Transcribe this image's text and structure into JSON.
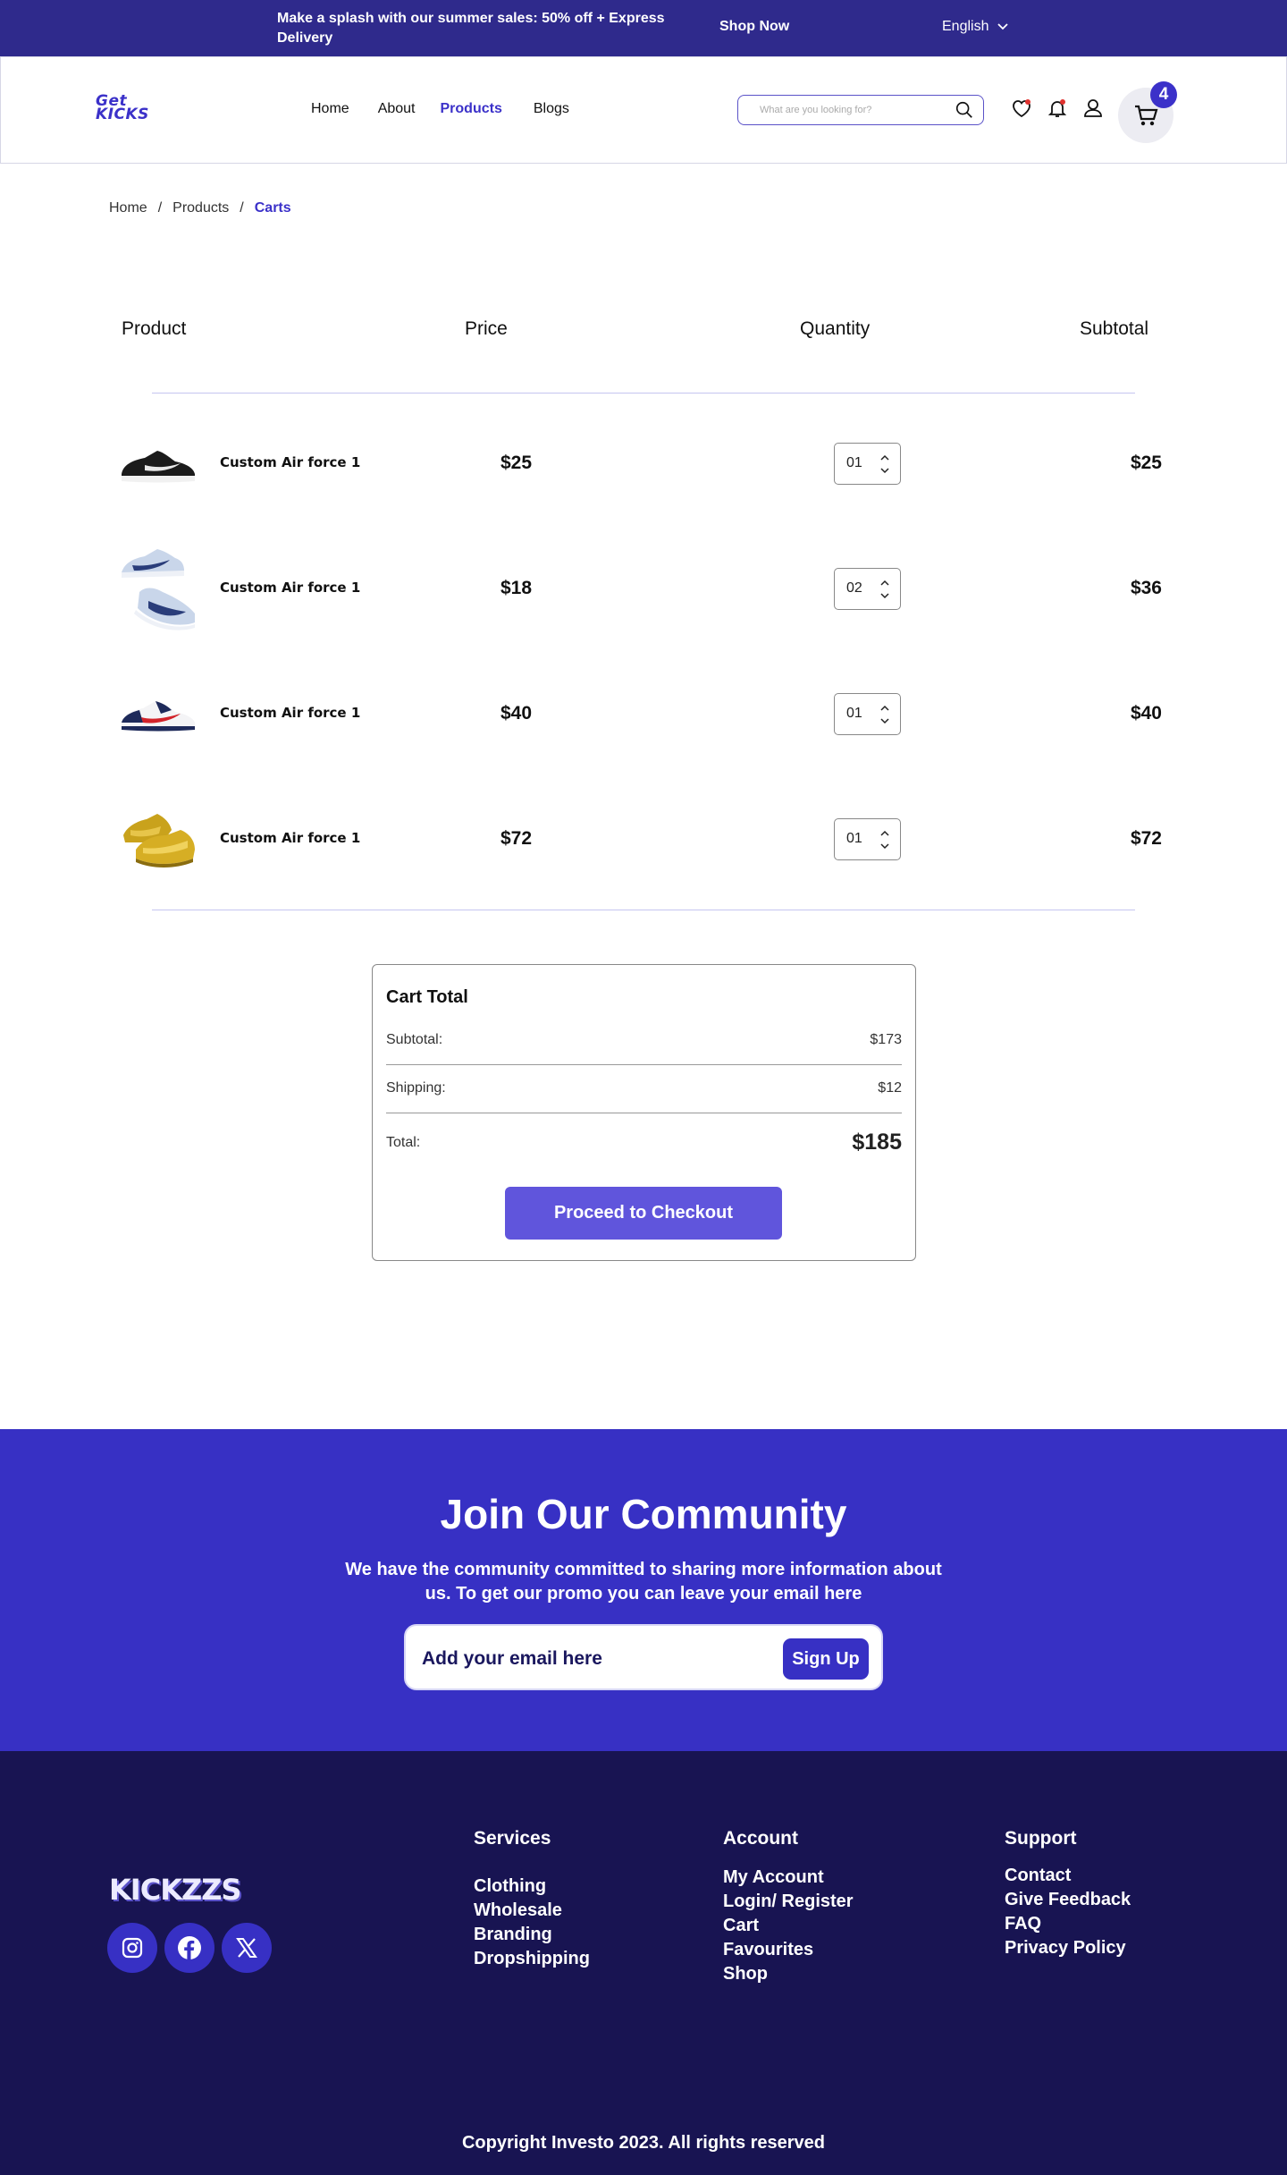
{
  "promo": {
    "message": "Make a splash with our summer sales: 50% off + Express Delivery",
    "shop_now": "Shop Now",
    "language": "English"
  },
  "header": {
    "logo_line1": "Get",
    "logo_line2": "KICKS",
    "nav": [
      "Home",
      "About",
      "Products",
      "Blogs"
    ],
    "active_nav": "Products",
    "search_placeholder": "What are you looking for?",
    "cart_count": "4"
  },
  "breadcrumb": {
    "items": [
      "Home",
      "Products",
      "Carts"
    ],
    "separator": "/"
  },
  "cart_table": {
    "headers": {
      "product": "Product",
      "price": "Price",
      "quantity": "Quantity",
      "subtotal": "Subtotal"
    },
    "rows": [
      {
        "name": "Custom Air force 1",
        "price": "$25",
        "qty": "01",
        "subtotal": "$25",
        "image": "black-white-sneaker"
      },
      {
        "name": "Custom Air force 1",
        "price": "$18",
        "qty": "02",
        "subtotal": "$36",
        "image": "blue-white-sneaker-pair"
      },
      {
        "name": "Custom Air force 1",
        "price": "$40",
        "qty": "01",
        "subtotal": "$40",
        "image": "navy-red-white-sneaker"
      },
      {
        "name": "Custom Air force 1",
        "price": "$72",
        "qty": "01",
        "subtotal": "$72",
        "image": "gold-sneaker-pair"
      }
    ]
  },
  "cart_total": {
    "title": "Cart Total",
    "subtotal_label": "Subtotal:",
    "subtotal_value": "$173",
    "shipping_label": "Shipping:",
    "shipping_value": "$12",
    "total_label": "Total:",
    "total_value": "$185",
    "checkout_label": "Proceed to Checkout"
  },
  "community": {
    "title": "Join Our Community",
    "text": "We have the community committed to sharing more information about us. To get our promo you can leave your email here",
    "email_placeholder": "Add your email here",
    "signup_label": "Sign Up"
  },
  "footer": {
    "logo": "KICKZZS",
    "services_title": "Services",
    "services": [
      "Clothing",
      "Wholesale",
      "Branding",
      "Dropshipping"
    ],
    "account_title": "Account",
    "account": [
      "My Account",
      "Login/ Register",
      "Cart",
      "Favourites",
      "Shop"
    ],
    "support_title": "Support",
    "support": [
      "Contact",
      "Give Feedback",
      "FAQ",
      "Privacy Policy"
    ],
    "social": [
      "instagram-icon",
      "facebook-icon",
      "x-icon"
    ],
    "copyright": "Copyright Investo 2023.  All rights reserved"
  },
  "colors": {
    "primary": "#3730c4",
    "promo_bar": "#2f2a8c",
    "footer_bg": "#181452",
    "checkout_button": "#6055dc"
  }
}
